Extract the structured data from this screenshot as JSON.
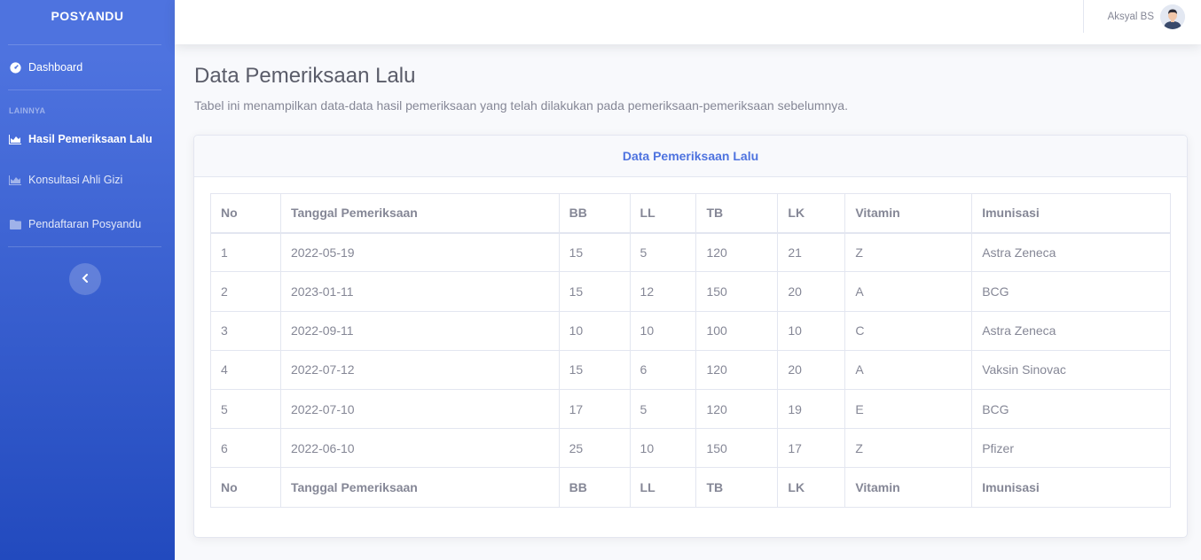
{
  "sidebar": {
    "brand": "POSYANDU",
    "dashboard": "Dashboard",
    "heading": "LAINNYA",
    "items": [
      {
        "label": "Hasil Pemeriksaan Lalu",
        "icon": "chart-area-icon"
      },
      {
        "label": "Konsultasi Ahli Gizi",
        "icon": "chart-area-icon"
      },
      {
        "label": "Pendaftaran Posyandu",
        "icon": "folder-icon"
      }
    ]
  },
  "topbar": {
    "user_name": "Aksyal BS"
  },
  "page": {
    "title": "Data Pemeriksaan Lalu",
    "description": "Tabel ini menampilkan data-data hasil pemeriksaan yang telah dilakukan pada pemeriksaan-pemeriksaan sebelumnya."
  },
  "card": {
    "title": "Data Pemeriksaan Lalu"
  },
  "table": {
    "columns": [
      "No",
      "Tanggal Pemeriksaan",
      "BB",
      "LL",
      "TB",
      "LK",
      "Vitamin",
      "Imunisasi"
    ],
    "rows": [
      [
        "1",
        "2022-05-19",
        "15",
        "5",
        "120",
        "21",
        "Z",
        "Astra Zeneca"
      ],
      [
        "2",
        "2023-01-11",
        "15",
        "12",
        "150",
        "20",
        "A",
        "BCG"
      ],
      [
        "3",
        "2022-09-11",
        "10",
        "10",
        "100",
        "10",
        "C",
        "Astra Zeneca"
      ],
      [
        "4",
        "2022-07-12",
        "15",
        "6",
        "120",
        "20",
        "A",
        "Vaksin Sinovac"
      ],
      [
        "5",
        "2022-07-10",
        "17",
        "5",
        "120",
        "19",
        "E",
        "BCG"
      ],
      [
        "6",
        "2022-06-10",
        "25",
        "10",
        "150",
        "17",
        "Z",
        "Pfizer"
      ]
    ]
  },
  "colors": {
    "primary": "#4e73df",
    "sidebar_end": "#224abe",
    "text_muted": "#858796"
  }
}
